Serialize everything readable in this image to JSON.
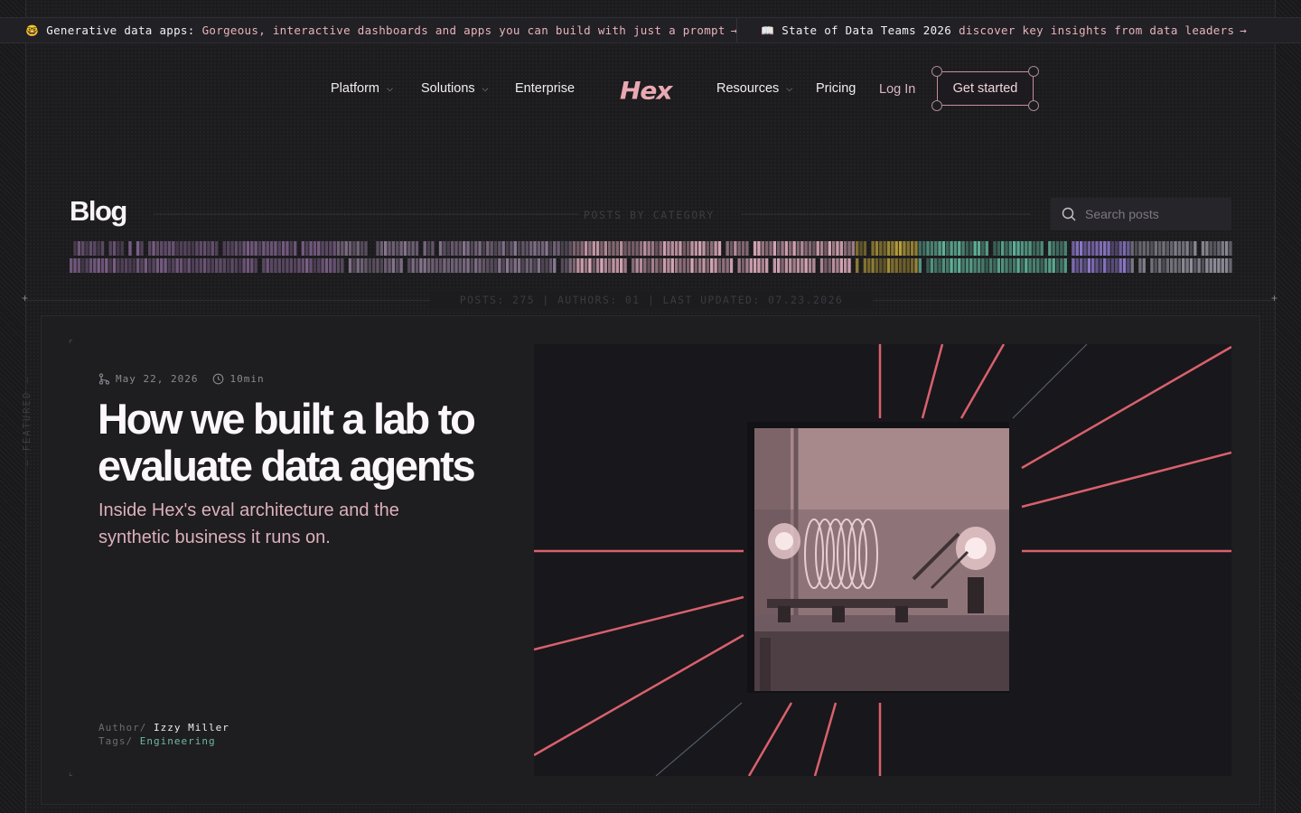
{
  "announcement": {
    "items": [
      {
        "emoji": "🤓",
        "label": "Generative data apps:",
        "link": "Gorgeous, interactive dashboards and apps you can build with just a prompt",
        "arrow": "→"
      },
      {
        "emoji": "📖",
        "label": "State of Data Teams 2026",
        "link": "discover key insights from data leaders",
        "arrow": "→"
      }
    ]
  },
  "nav": {
    "platform": "Platform",
    "solutions": "Solutions",
    "enterprise": "Enterprise",
    "logo": "Hex",
    "resources": "Resources",
    "pricing": "Pricing",
    "login": "Log In",
    "cta": "Get started"
  },
  "blog": {
    "title": "Blog",
    "category_label": "POSTS BY CATEGORY",
    "search_placeholder": "Search posts",
    "stats": "POSTS: 275 | AUTHORS: 01 | LAST UPDATED: 07.23.2026"
  },
  "featured": {
    "tab_label": "— FEATURED —",
    "date": "May 22, 2026",
    "read_time": "10min",
    "title": "How we built a lab to evaluate data agents",
    "subtitle": "Inside Hex's eval architecture and the synthetic business it runs on.",
    "author_key": "Author/",
    "author": "Izzy Miller",
    "tags_key": "Tags/",
    "tag": "Engineering"
  },
  "colors": {
    "background": "#1b1a1d",
    "accent_pink": "#e8a9b2",
    "ray_red": "#d9616c",
    "tag_teal": "#6fb8a5",
    "category_colors": [
      "#7a5f86",
      "#8a7891",
      "#d7a6b5",
      "#b8a03a",
      "#5fb39a",
      "#8c78c8",
      "#8f8d99"
    ]
  }
}
